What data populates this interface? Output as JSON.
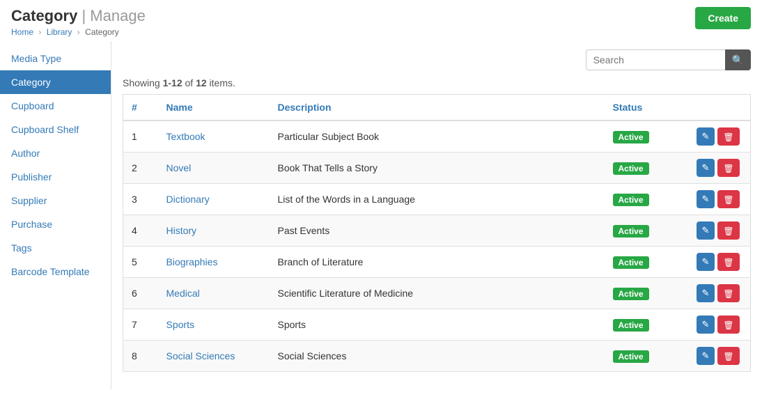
{
  "header": {
    "title": "Category",
    "subtitle": "Manage",
    "breadcrumb": [
      "Home",
      "Library",
      "Category"
    ]
  },
  "create_button_label": "Create",
  "sidebar": {
    "items": [
      {
        "label": "Media Type",
        "active": false
      },
      {
        "label": "Category",
        "active": true
      },
      {
        "label": "Cupboard",
        "active": false
      },
      {
        "label": "Cupboard Shelf",
        "active": false
      },
      {
        "label": "Author",
        "active": false
      },
      {
        "label": "Publisher",
        "active": false
      },
      {
        "label": "Supplier",
        "active": false
      },
      {
        "label": "Purchase",
        "active": false
      },
      {
        "label": "Tags",
        "active": false
      },
      {
        "label": "Barcode Template",
        "active": false
      }
    ]
  },
  "search": {
    "placeholder": "Search",
    "value": ""
  },
  "showing": {
    "from": "1-12",
    "total": "12",
    "text_pre": "Showing ",
    "text_mid": " of ",
    "text_post": " items."
  },
  "table": {
    "columns": [
      "#",
      "Name",
      "Description",
      "Status",
      ""
    ],
    "rows": [
      {
        "num": 1,
        "name": "Textbook",
        "description": "Particular Subject Book",
        "status": "Active"
      },
      {
        "num": 2,
        "name": "Novel",
        "description": "Book That Tells a Story",
        "status": "Active"
      },
      {
        "num": 3,
        "name": "Dictionary",
        "description": "List of the Words in a Language",
        "status": "Active"
      },
      {
        "num": 4,
        "name": "History",
        "description": "Past Events",
        "status": "Active"
      },
      {
        "num": 5,
        "name": "Biographies",
        "description": "Branch of Literature",
        "status": "Active"
      },
      {
        "num": 6,
        "name": "Medical",
        "description": "Scientific Literature of Medicine",
        "status": "Active"
      },
      {
        "num": 7,
        "name": "Sports",
        "description": "Sports",
        "status": "Active"
      },
      {
        "num": 8,
        "name": "Social Sciences",
        "description": "Social Sciences",
        "status": "Active"
      }
    ]
  }
}
